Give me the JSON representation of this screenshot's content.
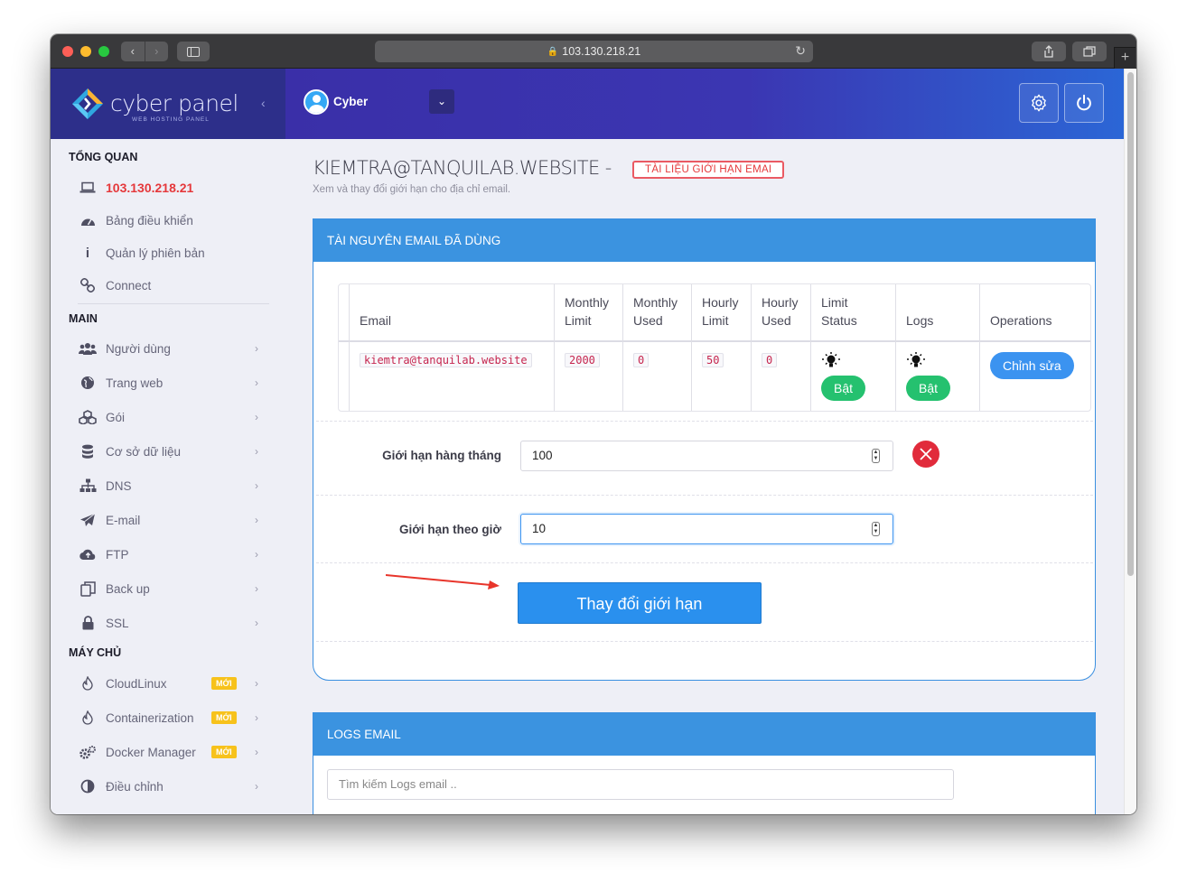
{
  "browser": {
    "url": "103.130.218.21"
  },
  "brand": {
    "name": "cyber panel",
    "tagline": "WEB HOSTING PANEL"
  },
  "header": {
    "user_name": "Cyber"
  },
  "sidebar": {
    "sections": [
      {
        "title": "TỔNG QUAN"
      },
      {
        "title": "MAIN"
      },
      {
        "title": "MÁY CHỦ"
      }
    ],
    "overview_items": [
      {
        "label": "103.130.218.21",
        "icon": "laptop-icon",
        "active": true
      },
      {
        "label": "Bảng điều khiển",
        "icon": "dashboard-icon"
      },
      {
        "label": "Quản lý phiên bản",
        "icon": "info-icon"
      },
      {
        "label": "Connect",
        "icon": "link-icon"
      }
    ],
    "main_items": [
      {
        "label": "Người dùng",
        "icon": "users-icon"
      },
      {
        "label": "Trang web",
        "icon": "globe-icon"
      },
      {
        "label": "Gói",
        "icon": "cubes-icon"
      },
      {
        "label": "Cơ sở dữ liệu",
        "icon": "database-icon"
      },
      {
        "label": "DNS",
        "icon": "sitemap-icon"
      },
      {
        "label": "E-mail",
        "icon": "paper-plane-icon"
      },
      {
        "label": "FTP",
        "icon": "cloud-upload-icon"
      },
      {
        "label": "Back up",
        "icon": "copy-icon"
      },
      {
        "label": "SSL",
        "icon": "lock-icon"
      }
    ],
    "server_items": [
      {
        "label": "CloudLinux",
        "icon": "fire-icon",
        "badge": "MỚI"
      },
      {
        "label": "Containerization",
        "icon": "fire-icon",
        "badge": "MỚI"
      },
      {
        "label": "Docker Manager",
        "icon": "cogs-icon",
        "badge": "MỚI"
      },
      {
        "label": "Điều chỉnh",
        "icon": "adjust-icon"
      }
    ]
  },
  "page": {
    "title": "KIEMTRA@TANQUILAB.WEBSITE -",
    "doc_link": "TÀI LIỆU GIỚI HẠN EMAI",
    "subtitle": "Xem và thay đổi giới hạn cho địa chỉ email."
  },
  "usage_card": {
    "title": "TÀI NGUYÊN EMAIL ĐÃ DÙNG",
    "columns": {
      "email": "Email",
      "monthly_limit_1": "Monthly",
      "monthly_limit_2": "Limit",
      "monthly_used_1": "Monthly",
      "monthly_used_2": "Used",
      "hourly_limit_1": "Hourly",
      "hourly_limit_2": "Limit",
      "hourly_used_1": "Hourly",
      "hourly_used_2": "Used",
      "limit_status_1": "Limit",
      "limit_status_2": "Status",
      "logs": "Logs",
      "operations": "Operations"
    },
    "row": {
      "email": "kiemtra@tanquilab.website",
      "monthly_limit": "2000",
      "monthly_used": "0",
      "hourly_limit": "50",
      "hourly_used": "0",
      "limit_status": "Bật",
      "logs": "Bật",
      "edit_label": "Chỉnh sửa"
    },
    "form": {
      "monthly_label": "Giới hạn hàng tháng",
      "monthly_value": "100",
      "hourly_label": "Giới hạn theo giờ",
      "hourly_value": "10",
      "submit_label": "Thay đổi giới hạn"
    }
  },
  "logs_card": {
    "title": "LOGS EMAIL",
    "search_placeholder": "Tìm kiếm Logs email .."
  },
  "colors": {
    "brand_dark": "#2d2f8a",
    "header_gradient_end": "#2b66d6",
    "card_header": "#3b93e0",
    "active_red": "#e5383b",
    "badge_yellow": "#f7c21b",
    "success_green": "#25c16f"
  }
}
